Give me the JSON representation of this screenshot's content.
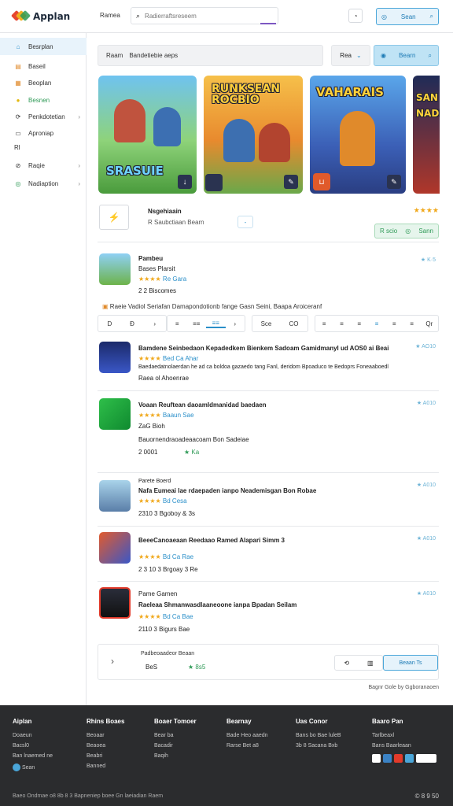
{
  "header": {
    "app_name": "Applan",
    "nav_label": "Ramea",
    "search_placeholder": "Radierraftsreseem",
    "cta_label": "Sean",
    "colors": {
      "accent": "#2a8fc9",
      "purple": "#7d57c2"
    }
  },
  "sidebar": {
    "items": [
      {
        "label": "Besrplan",
        "icon": "home-icon"
      },
      {
        "label": "Baseil",
        "icon": "list-icon"
      },
      {
        "label": "Beoplan",
        "icon": "people-icon"
      },
      {
        "label": "Besnen",
        "icon": "coin-icon"
      },
      {
        "label": "Penkdotetian",
        "icon": "share-icon"
      },
      {
        "label": "Aproniap",
        "icon": "doc-icon"
      },
      {
        "label": "Rl",
        "icon": "flag-icon"
      },
      {
        "label": "Raqie",
        "icon": "tag-icon"
      },
      {
        "label": "Nadiaption",
        "icon": "compass-icon"
      }
    ]
  },
  "main": {
    "search_label": "Raam",
    "search_value": "Bandetiebie aeps",
    "filter_label": "Rea",
    "search_button": "Bearn",
    "banners": [
      {
        "title": "SRASUIE",
        "icon": "download-icon"
      },
      {
        "title": "RUNKSEAN ROCBIO",
        "icon": "edit-icon"
      },
      {
        "title": "VAHARAIS",
        "icon": "edit-icon"
      },
      {
        "title": "SAN NADIO",
        "icon": "none"
      }
    ],
    "feature": {
      "title": "Nsgehiaain",
      "subtitle": "R Saubctiaan Bearn",
      "subtitle2": "SSam",
      "chip": "-",
      "stars": "★★★★",
      "tag": "R scio",
      "tag_right": "Sann"
    },
    "first_app": {
      "name": "Pambeu",
      "dev": "Bases Plarsit",
      "stars": "★★★★",
      "rating_text": "Re Gara",
      "meta": "2  2 Biscomes",
      "rt": "★ K·5"
    },
    "notice": "Raeie Vadiol Seriafan Damapondotionb fange Gasn Seini, Baapa Aroiceranf",
    "toolbar": [
      "D",
      "Đ",
      "›",
      "≡",
      "≡≡",
      "≡≡",
      "›",
      "Sce",
      "CO",
      "≡",
      "≡",
      "≡",
      "≡",
      "≡",
      "≡",
      "≡",
      "Qr"
    ],
    "apps": [
      {
        "title": "Bamdene Seinbedaon Kepadedkem Bienkem Sadoam Gamidmanyl ud AOS0 ai Beai",
        "desc": "Baedaedatnolaerdan he  ad ca boldoa gazaedo tang Fanl, deridom Bpoaduco te Bedoprs Foneaaboedl",
        "meta": "Raea ol Ahoenrae",
        "stars": "★★★★",
        "rating": "Bed Ca Ahar",
        "rt": "★ AO10"
      },
      {
        "title": "Voaan Reuftean daoamIdmanidad  baedaen",
        "desc": "Bauornendraoadeaacoam  Bon Sadeiae",
        "meta": "2  0001",
        "stars": "★★★★",
        "rating": "Baaun Sae",
        "rt": "★ A010",
        "extra": "★ Ka",
        "sub": "ZaG  Bioh"
      },
      {
        "title": "Nafa Eumeai  lae rdaepaden ianpo  Neademisgan  Bon Robae",
        "desc": "",
        "meta": "2310  3  Bgoboy & 3s",
        "stars": "★★★★",
        "rating": "Bd Cesa",
        "rt": "★ A010",
        "sub": "Parete Boerd"
      },
      {
        "title": "BeeeCanoaeaan Reedaao Ramed Alapari Simm 3",
        "desc": "",
        "meta": "2 3 10  3  Brgoay 3 Re",
        "stars": "★★★★",
        "rating": "Bd Ca Rae",
        "rt": "★ A010"
      },
      {
        "title": "Raeleaa Shmanwasdlaaneoone ianpa Bpadan Seilam",
        "desc": "",
        "meta": "2110  3  Bigurs Bae",
        "stars": "★★★★",
        "rating": "Bd Ca Bae",
        "rt": "★ A010",
        "sub": "Pame Gamen"
      }
    ],
    "bottom_card": {
      "label": "Padbeoaadeor Beaan",
      "price": "BeS",
      "rating": "★ 8s5",
      "button": "Beaan  Ts"
    },
    "pagination_text": "Bagnr Gole by Ggboranaoen"
  },
  "footer": {
    "columns": [
      {
        "heading": "Aiplan",
        "items": [
          "Doaeun",
          "Bacsl0",
          "Ban lnaemed ne",
          "Sean"
        ]
      },
      {
        "heading": "Rhins Boaes",
        "items": [
          "Beoaar",
          "Beaoea",
          "Beabri",
          "Banned"
        ]
      },
      {
        "heading": "Boaer Tomoer",
        "items": [
          "Bear ba",
          "Bacadir",
          "Baqih"
        ]
      },
      {
        "heading": "Bearnay",
        "items": [
          "Bade Heo aaedn",
          "Rarse Bet a8"
        ]
      },
      {
        "heading": "Uas Conor",
        "items": [
          "Bans bo Bae luleB",
          "3b 8 Sacana Bxb"
        ]
      },
      {
        "heading": "Baaro Pan",
        "items": [
          "Tarlbeaxl",
          "Bans Baarleaan"
        ]
      }
    ],
    "copyright": "Baeo Ondmae o8 8b 8 3 Bapneniep boee Gn laeiadian Raem",
    "social": "©  8  9  50"
  }
}
